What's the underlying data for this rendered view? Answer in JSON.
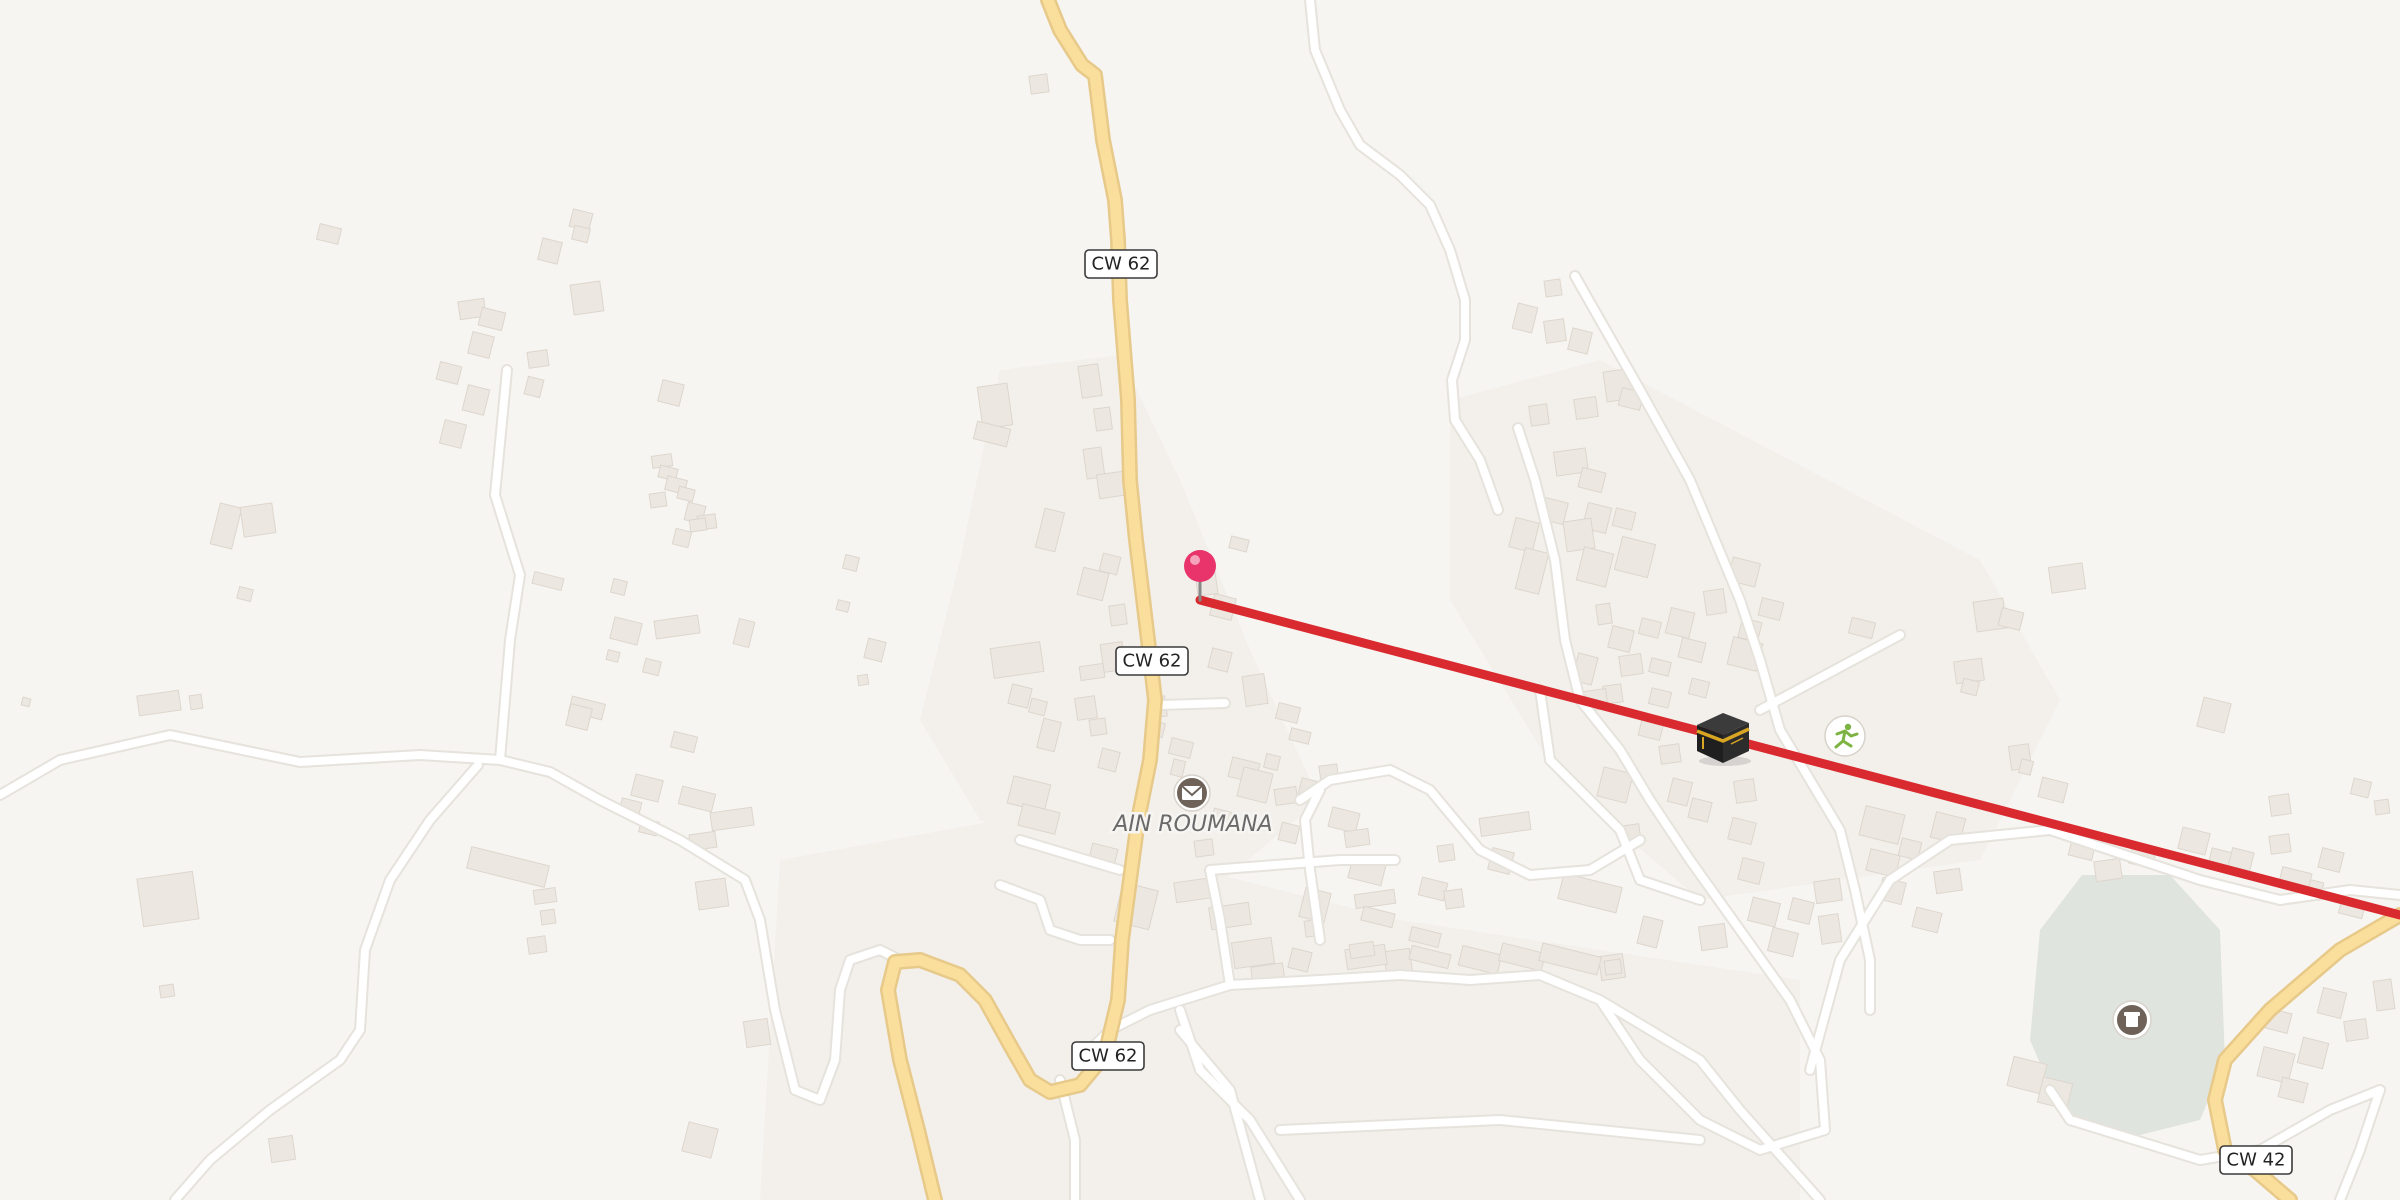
{
  "map": {
    "place_label": "AIN ROUMANA",
    "road_shields": {
      "cw62_north": "CW 62",
      "cw62_mid": "CW 62",
      "cw62_south": "CW 62",
      "cw42": "CW 42"
    },
    "colors": {
      "background": "#f7f5f2",
      "route_line": "#d92b2f",
      "pin_head": "#e8336b",
      "park_area": "#dfe4de",
      "major_road": "#fadf9c",
      "minor_road": "#ffffff",
      "poi_icon": "#6f6359",
      "sport_icon": "#7cb342"
    },
    "icons": {
      "pin": "location-pin-icon",
      "destination": "kaaba-icon",
      "post_office": "envelope-icon",
      "sports": "running-person-icon",
      "cemetery": "grave-icon"
    }
  }
}
